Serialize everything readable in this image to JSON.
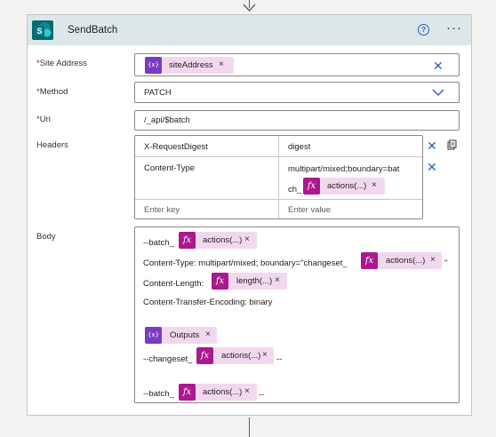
{
  "step": {
    "title": "SendBatch",
    "help_glyph": "?",
    "more_glyph": "···"
  },
  "site_address": {
    "label": "Site Address",
    "required_mark": "*",
    "token_label": "siteAddress",
    "token_icon": "{x}"
  },
  "method": {
    "label": "Method",
    "required_mark": "*",
    "value": "PATCH"
  },
  "uri": {
    "label": "Uri",
    "required_mark": "*",
    "value": "/_api/$batch"
  },
  "headers": {
    "label": "Headers",
    "rows": [
      {
        "key": "X-RequestDigest",
        "value": "digest"
      },
      {
        "key": "Content-Type",
        "value_line1": "multipart/mixed;boundary=bat",
        "value_line2": "ch_",
        "value_token": "actions(...)"
      }
    ],
    "key_placeholder": "Enter key",
    "value_placeholder": "Enter value"
  },
  "body": {
    "label": "Body",
    "line1_prefix": "--batch_",
    "line1_token": "actions(...)",
    "line2_prefix": "Content-Type: multipart/mixed; boundary=\"changeset_",
    "line2_token": "actions(...)",
    "line2_suffix": "\"",
    "line3_prefix": "Content-Length:",
    "line3_token": "length(...)",
    "line4": "Content-Transfer-Encoding: binary",
    "outputs_token": "Outputs",
    "line6_prefix": "--changeset_",
    "line6_token": "actions(...)",
    "line6_suffix": "--",
    "line7_prefix": "--batch_",
    "line7_token": "actions(...)",
    "line7_suffix": "--"
  },
  "glyphs": {
    "fx": "fx",
    "remove": "×",
    "clear": "✕"
  },
  "colors": {
    "expression_token_icon": "#aa198d",
    "variable_token_icon": "#7b3ac3",
    "token_background": "#f2d8ee",
    "header_background": "#dbe7e8",
    "accent": "#2b5fbf"
  }
}
